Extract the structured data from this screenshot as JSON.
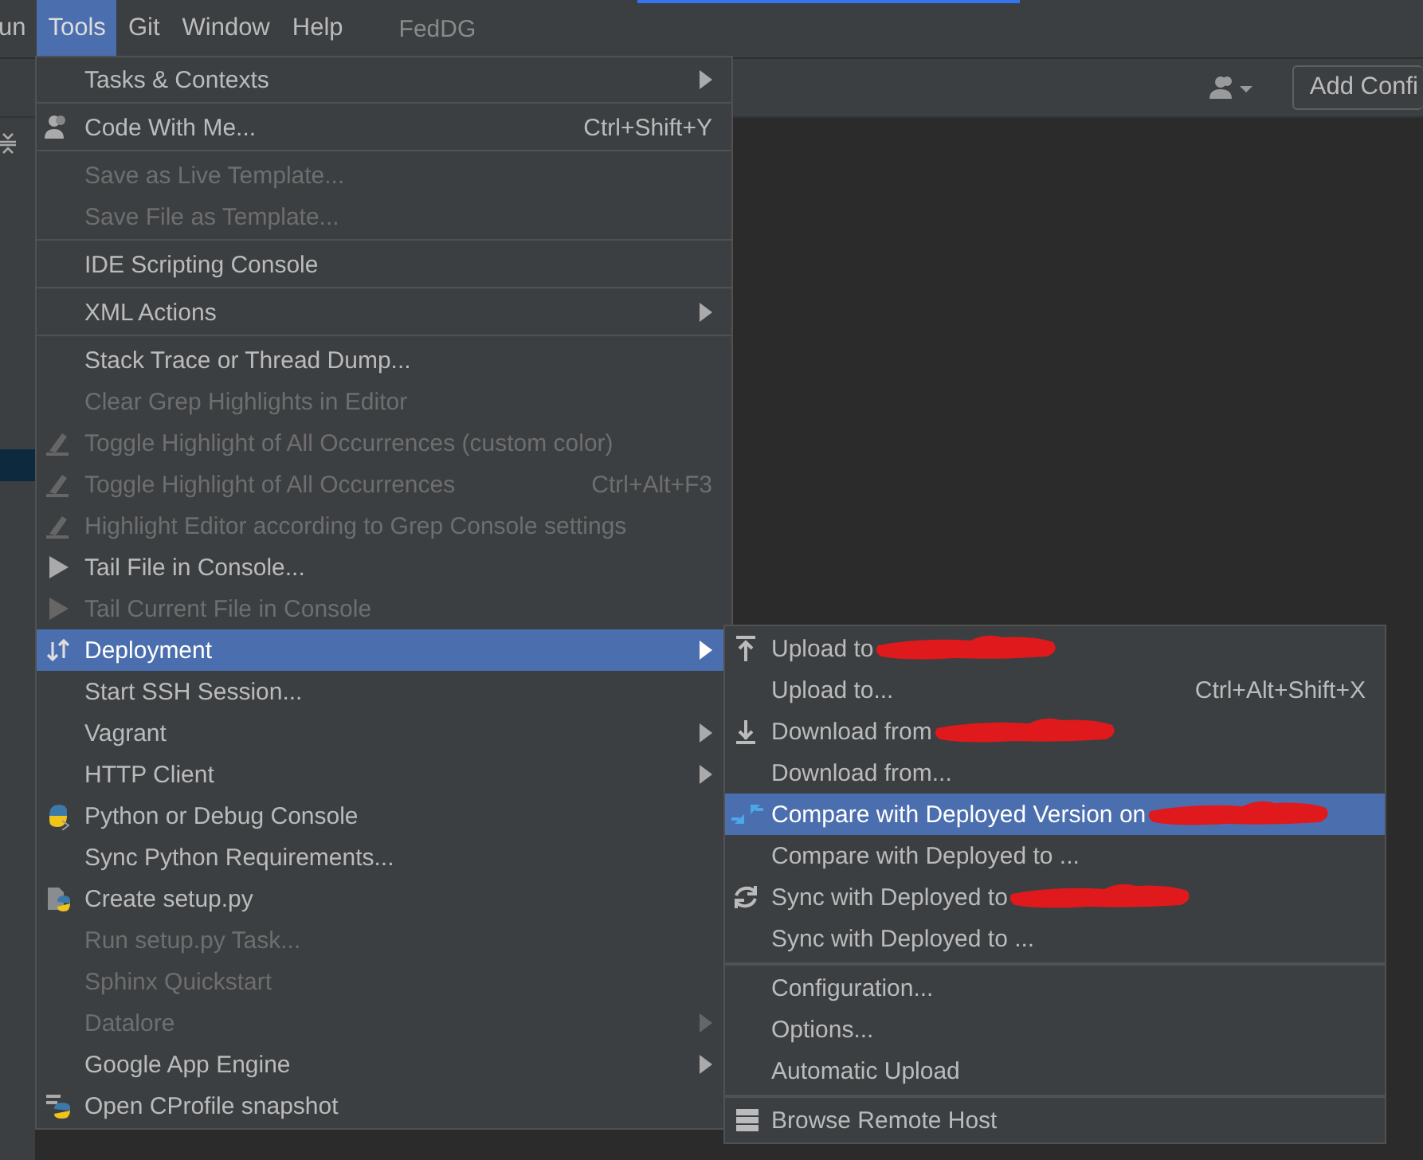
{
  "menubar": {
    "items": [
      {
        "label": "un",
        "selected": false
      },
      {
        "label": "Tools",
        "selected": true
      },
      {
        "label": "Git",
        "selected": false
      },
      {
        "label": "Window",
        "selected": false
      },
      {
        "label": "Help",
        "selected": false
      }
    ],
    "project_title": "FedDG"
  },
  "toolbar": {
    "add_configuration": "Add Confi"
  },
  "tools_menu": {
    "items": [
      {
        "kind": "plain",
        "label": "Tasks & Contexts",
        "disabled": false,
        "submenu": true,
        "selected": false
      },
      {
        "kind": "separator"
      },
      {
        "kind": "people",
        "label": "Code With Me...",
        "shortcut": "Ctrl+Shift+Y",
        "disabled": false,
        "submenu": false,
        "selected": false
      },
      {
        "kind": "separator"
      },
      {
        "kind": "plain",
        "label": "Save as Live Template...",
        "disabled": true,
        "submenu": false,
        "selected": false
      },
      {
        "kind": "plain",
        "label": "Save File as Template...",
        "disabled": true,
        "submenu": false,
        "selected": false
      },
      {
        "kind": "separator"
      },
      {
        "kind": "plain",
        "label": "IDE Scripting Console",
        "disabled": false,
        "submenu": false,
        "selected": false
      },
      {
        "kind": "separator"
      },
      {
        "kind": "plain",
        "label": "XML Actions",
        "disabled": false,
        "submenu": true,
        "selected": false
      },
      {
        "kind": "separator"
      },
      {
        "kind": "plain",
        "label": "Stack Trace or Thread Dump...",
        "disabled": false,
        "submenu": false,
        "selected": false
      },
      {
        "kind": "plain",
        "label": "Clear Grep Highlights in Editor",
        "disabled": true,
        "submenu": false,
        "selected": false
      },
      {
        "kind": "highlighter",
        "label": "Toggle Highlight of All Occurrences (custom color)",
        "disabled": true,
        "submenu": false,
        "selected": false
      },
      {
        "kind": "highlighter",
        "label": "Toggle Highlight of All Occurrences",
        "shortcut": "Ctrl+Alt+F3",
        "disabled": true,
        "submenu": false,
        "selected": false
      },
      {
        "kind": "highlighter",
        "label": "Highlight Editor according to Grep Console settings",
        "disabled": true,
        "submenu": false,
        "selected": false
      },
      {
        "kind": "play",
        "label": "Tail File in Console...",
        "disabled": false,
        "submenu": false,
        "selected": false
      },
      {
        "kind": "play",
        "label": "Tail Current File in Console",
        "disabled": true,
        "submenu": false,
        "selected": false
      },
      {
        "kind": "transfer",
        "label": "Deployment",
        "disabled": false,
        "submenu": true,
        "selected": true
      },
      {
        "kind": "plain",
        "label": "Start SSH Session...",
        "disabled": false,
        "submenu": false,
        "selected": false
      },
      {
        "kind": "plain",
        "label": "Vagrant",
        "disabled": false,
        "submenu": true,
        "selected": false
      },
      {
        "kind": "plain",
        "label": "HTTP Client",
        "disabled": false,
        "submenu": true,
        "selected": false
      },
      {
        "kind": "python",
        "label": "Python or Debug Console",
        "disabled": false,
        "submenu": false,
        "selected": false
      },
      {
        "kind": "plain",
        "label": "Sync Python Requirements...",
        "disabled": false,
        "submenu": false,
        "selected": false
      },
      {
        "kind": "python-file",
        "label": "Create setup.py",
        "disabled": false,
        "submenu": false,
        "selected": false
      },
      {
        "kind": "plain",
        "label": "Run setup.py Task...",
        "disabled": true,
        "submenu": false,
        "selected": false
      },
      {
        "kind": "plain",
        "label": "Sphinx Quickstart",
        "disabled": true,
        "submenu": false,
        "selected": false
      },
      {
        "kind": "plain",
        "label": "Datalore",
        "disabled": true,
        "submenu": true,
        "selected": false
      },
      {
        "kind": "plain",
        "label": "Google App Engine",
        "disabled": false,
        "submenu": true,
        "selected": false
      },
      {
        "kind": "python-profile",
        "label": "Open CProfile snapshot",
        "disabled": false,
        "submenu": false,
        "selected": false
      }
    ]
  },
  "deployment_menu": {
    "items": [
      {
        "kind": "upload",
        "label": "Upload to",
        "redacted": true,
        "selected": false
      },
      {
        "kind": "plain",
        "label": "Upload to...",
        "shortcut": "Ctrl+Alt+Shift+X",
        "redacted": false,
        "selected": false
      },
      {
        "kind": "download",
        "label": "Download from",
        "redacted": true,
        "selected": false
      },
      {
        "kind": "plain",
        "label": "Download from...",
        "redacted": false,
        "selected": false
      },
      {
        "kind": "compare",
        "label": "Compare with Deployed Version on",
        "redacted": true,
        "selected": true
      },
      {
        "kind": "plain",
        "label": "Compare with Deployed to ...",
        "redacted": false,
        "selected": false
      },
      {
        "kind": "sync",
        "label": "Sync with Deployed to",
        "redacted": true,
        "selected": false
      },
      {
        "kind": "plain",
        "label": "Sync with Deployed to ...",
        "redacted": false,
        "selected": false
      },
      {
        "kind": "separator"
      },
      {
        "kind": "plain",
        "label": "Configuration...",
        "redacted": false,
        "selected": false
      },
      {
        "kind": "plain",
        "label": "Options...",
        "redacted": false,
        "selected": false
      },
      {
        "kind": "plain",
        "label": "Automatic Upload",
        "redacted": false,
        "selected": false
      },
      {
        "kind": "separator"
      },
      {
        "kind": "server",
        "label": "Browse Remote Host",
        "redacted": false,
        "selected": false
      }
    ]
  }
}
